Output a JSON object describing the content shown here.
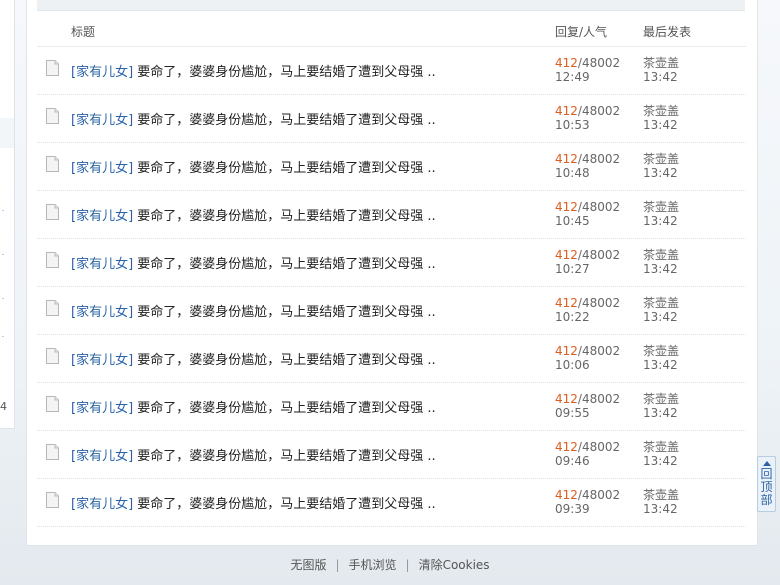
{
  "table_header": {
    "title": "标题",
    "stats": "回复/人气",
    "last_post": "最后发表"
  },
  "threads": [
    {
      "category": "[家有儿女]",
      "title": "要命了，婆婆身份尴尬，马上要结婚了遭到父母强 ..",
      "replies": "412",
      "views": "/48002",
      "time": "12:49",
      "last_author": "茶壶盖",
      "last_time": "13:42"
    },
    {
      "category": "[家有儿女]",
      "title": "要命了，婆婆身份尴尬，马上要结婚了遭到父母强 ..",
      "replies": "412",
      "views": "/48002",
      "time": "10:53",
      "last_author": "茶壶盖",
      "last_time": "13:42"
    },
    {
      "category": "[家有儿女]",
      "title": "要命了，婆婆身份尴尬，马上要结婚了遭到父母强 ..",
      "replies": "412",
      "views": "/48002",
      "time": "10:48",
      "last_author": "茶壶盖",
      "last_time": "13:42"
    },
    {
      "category": "[家有儿女]",
      "title": "要命了，婆婆身份尴尬，马上要结婚了遭到父母强 ..",
      "replies": "412",
      "views": "/48002",
      "time": "10:45",
      "last_author": "茶壶盖",
      "last_time": "13:42"
    },
    {
      "category": "[家有儿女]",
      "title": "要命了，婆婆身份尴尬，马上要结婚了遭到父母强 ..",
      "replies": "412",
      "views": "/48002",
      "time": "10:27",
      "last_author": "茶壶盖",
      "last_time": "13:42"
    },
    {
      "category": "[家有儿女]",
      "title": "要命了，婆婆身份尴尬，马上要结婚了遭到父母强 ..",
      "replies": "412",
      "views": "/48002",
      "time": "10:22",
      "last_author": "茶壶盖",
      "last_time": "13:42"
    },
    {
      "category": "[家有儿女]",
      "title": "要命了，婆婆身份尴尬，马上要结婚了遭到父母强 ..",
      "replies": "412",
      "views": "/48002",
      "time": "10:06",
      "last_author": "茶壶盖",
      "last_time": "13:42"
    },
    {
      "category": "[家有儿女]",
      "title": "要命了，婆婆身份尴尬，马上要结婚了遭到父母强 ..",
      "replies": "412",
      "views": "/48002",
      "time": "09:55",
      "last_author": "茶壶盖",
      "last_time": "13:42"
    },
    {
      "category": "[家有儿女]",
      "title": "要命了，婆婆身份尴尬，马上要结婚了遭到父母强 ..",
      "replies": "412",
      "views": "/48002",
      "time": "09:46",
      "last_author": "茶壶盖",
      "last_time": "13:42"
    },
    {
      "category": "[家有儿女]",
      "title": "要命了，婆婆身份尴尬，马上要结婚了遭到父母强 ..",
      "replies": "412",
      "views": "/48002",
      "time": "09:39",
      "last_author": "茶壶盖",
      "last_time": "13:42"
    }
  ],
  "footer": {
    "links": [
      "无图版",
      "手机浏览",
      "清除Cookies"
    ],
    "separator": "|"
  },
  "sidebar_fragment": {
    "number": "4"
  },
  "back_to_top": {
    "label": "回顶部",
    "icon": "arrow-up-icon"
  },
  "colors": {
    "category_link": "#2a63a6",
    "reply_count": "#e05a21"
  }
}
